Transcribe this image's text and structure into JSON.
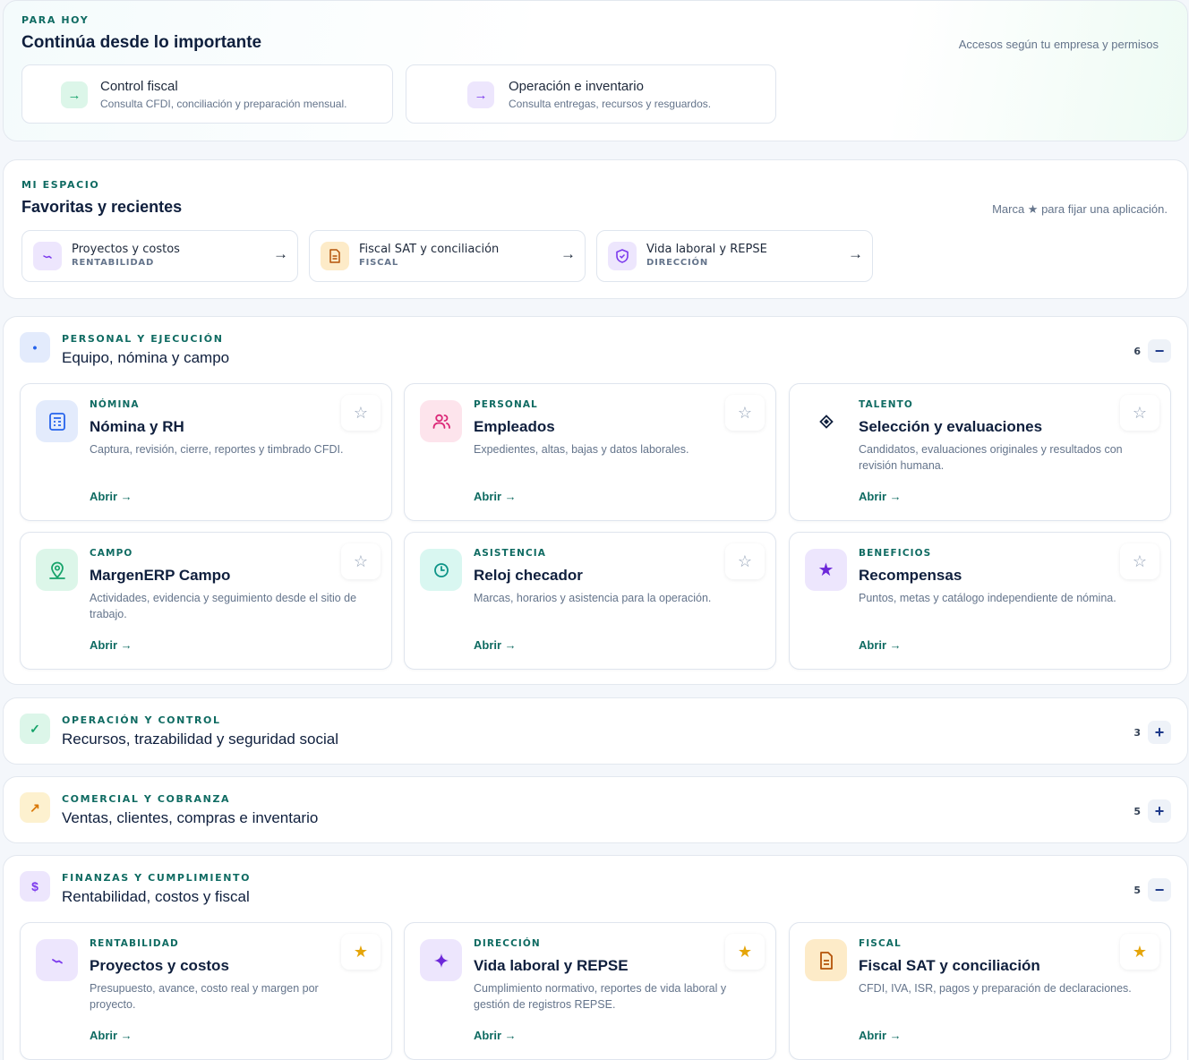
{
  "today": {
    "eyebrow": "PARA HOY",
    "title": "Continúa desde lo importante",
    "right_note": "Accesos según tu empresa y permisos",
    "cards": [
      {
        "title": "Control fiscal",
        "desc": "Consulta CFDI, conciliación y preparación mensual.",
        "icon": "arrow-right-icon",
        "color": "#16a36a"
      },
      {
        "title": "Operación e inventario",
        "desc": "Consulta entregas, recursos y resguardos.",
        "icon": "arrow-right-icon",
        "color": "#7c3aed"
      }
    ]
  },
  "favorites": {
    "eyebrow": "MI ESPACIO",
    "title": "Favoritas y recientes",
    "right_note": "Marca ★ para fijar una aplicación.",
    "items": [
      {
        "title": "Proyectos y costos",
        "sub": "RENTABILIDAD",
        "arrow": "→"
      },
      {
        "title": "Fiscal SAT y conciliación",
        "sub": "FISCAL",
        "arrow": "→"
      },
      {
        "title": "Vida laboral y REPSE",
        "sub": "DIRECCIÓN",
        "arrow": "→"
      }
    ]
  },
  "sections": [
    {
      "eyebrow": "PERSONAL Y EJECUCIÓN",
      "title": "Equipo, nómina y campo",
      "icon_glyph": "•",
      "count": "6",
      "toggle": "−",
      "expanded": true,
      "apps": [
        {
          "category": "NÓMINA",
          "title": "Nómina y RH",
          "desc": "Captura, revisión, cierre, reportes y timbrado CFDI.",
          "open": "Abrir →",
          "starred": false
        },
        {
          "category": "PERSONAL",
          "title": "Empleados",
          "desc": "Expedientes, altas, bajas y datos laborales.",
          "open": "Abrir →",
          "starred": false
        },
        {
          "category": "TALENTO",
          "title": "Selección y evaluaciones",
          "desc": "Candidatos, evaluaciones originales y resultados con revisión humana.",
          "open": "Abrir →",
          "starred": false
        },
        {
          "category": "CAMPO",
          "title": "MargenERP Campo",
          "desc": "Actividades, evidencia y seguimiento desde el sitio de trabajo.",
          "open": "Abrir →",
          "starred": false
        },
        {
          "category": "ASISTENCIA",
          "title": "Reloj checador",
          "desc": "Marcas, horarios y asistencia para la operación.",
          "open": "Abrir →",
          "starred": false
        },
        {
          "category": "BENEFICIOS",
          "title": "Recompensas",
          "desc": "Puntos, metas y catálogo independiente de nómina.",
          "open": "Abrir →",
          "starred": false
        }
      ]
    },
    {
      "eyebrow": "OPERACIÓN Y CONTROL",
      "title": "Recursos, trazabilidad y seguridad social",
      "icon_glyph": "✓",
      "count": "3",
      "toggle": "+",
      "expanded": false
    },
    {
      "eyebrow": "COMERCIAL Y COBRANZA",
      "title": "Ventas, clientes, compras e inventario",
      "icon_glyph": "↗",
      "count": "5",
      "toggle": "+",
      "expanded": false
    },
    {
      "eyebrow": "FINANZAS Y CUMPLIMIENTO",
      "title": "Rentabilidad, costos y fiscal",
      "icon_glyph": "$",
      "count": "5",
      "toggle": "−",
      "expanded": true,
      "apps": [
        {
          "category": "RENTABILIDAD",
          "title": "Proyectos y costos",
          "desc": "Presupuesto, avance, costo real y margen por proyecto.",
          "open": "Abrir →",
          "starred": true
        },
        {
          "category": "DIRECCIÓN",
          "title": "Vida laboral y REPSE",
          "desc": "Cumplimiento normativo, reportes de vida laboral y gestión de registros REPSE.",
          "open": "Abrir →",
          "starred": true
        },
        {
          "category": "FISCAL",
          "title": "Fiscal SAT y conciliación",
          "desc": "CFDI, IVA, ISR, pagos y preparación de declaraciones.",
          "open": "Abrir →",
          "starred": true
        }
      ]
    }
  ],
  "star_glyphs": {
    "on": "★",
    "off": "☆"
  },
  "colors": {
    "accent_teal": "#0f6b62",
    "title_navy": "#0f1f3d",
    "star_gold": "#e5a50a"
  }
}
